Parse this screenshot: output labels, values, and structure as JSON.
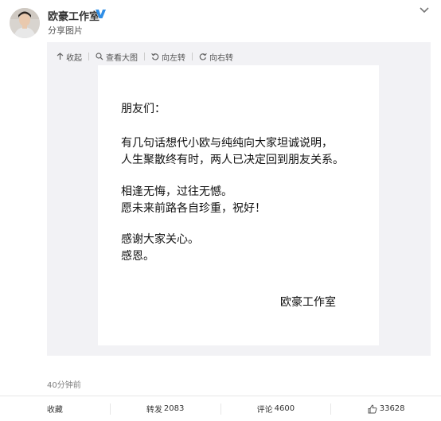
{
  "post": {
    "author": "欧豪工作室",
    "subtitle": "分享图片",
    "time": "40分钟前"
  },
  "viewer": {
    "toolbar": {
      "collapse": "收起",
      "view_large": "查看大图",
      "rotate_left": "向左转",
      "rotate_right": "向右转"
    },
    "letter": {
      "greeting": "朋友们：",
      "p1_line1": "有几句话想代小欧与纯纯向大家坦诚说明，",
      "p1_line2": "人生聚散终有时，两人已决定回到朋友关系。",
      "p2_line1": "相逢无悔，过往无憾。",
      "p2_line2": "愿未来前路各自珍重，祝好！",
      "p3_line1": "感谢大家关心。",
      "p3_line2": "感恩。",
      "signature": "欧豪工作室"
    }
  },
  "actions": {
    "favorite": "收藏",
    "repost_label": "转发",
    "repost_count": "2083",
    "comment_label": "评论",
    "comment_count": "4600",
    "like_count": "33628"
  },
  "colors": {
    "verified": "#2f8ee6",
    "viewer_bg": "#f2f2f5"
  }
}
